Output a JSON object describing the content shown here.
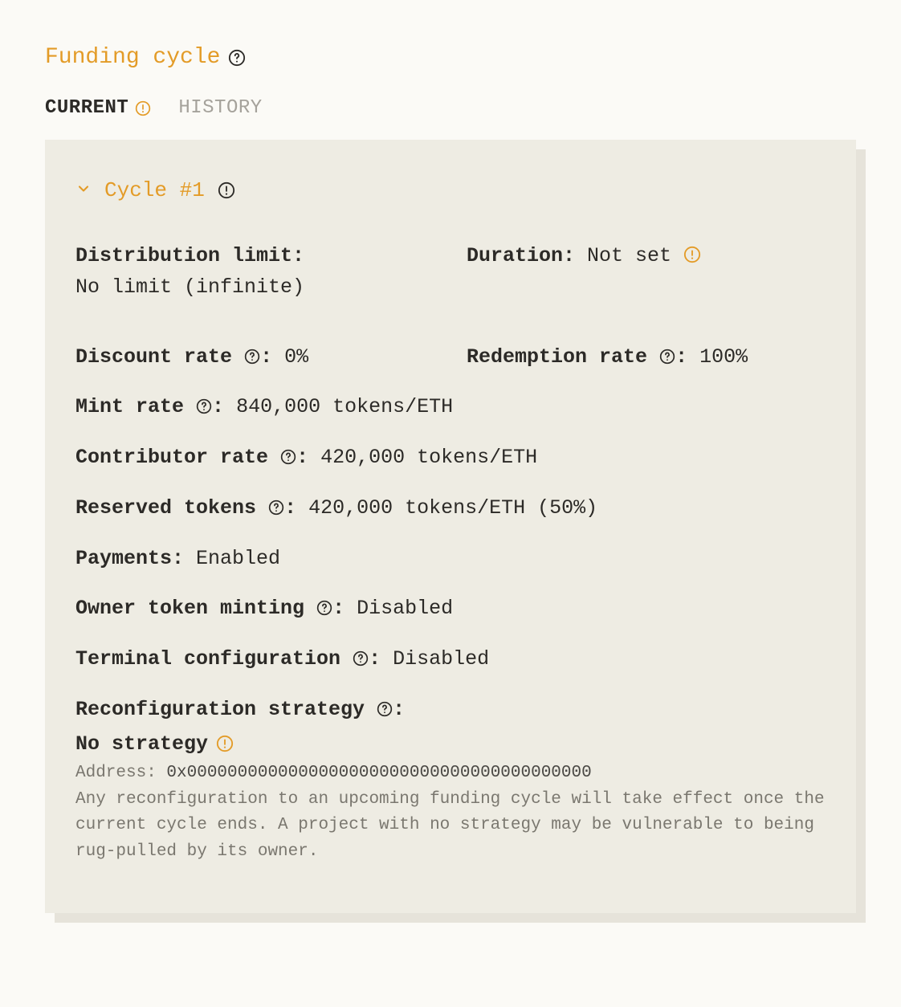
{
  "section": {
    "title": "Funding cycle"
  },
  "tabs": {
    "current": "CURRENT",
    "history": "HISTORY"
  },
  "cycle": {
    "title": "Cycle #1"
  },
  "fields": {
    "distribution_limit": {
      "label": "Distribution limit",
      "value": "No limit (infinite)"
    },
    "duration": {
      "label": "Duration",
      "value": "Not set"
    },
    "discount_rate": {
      "label": "Discount rate",
      "value": "0%"
    },
    "redemption_rate": {
      "label": "Redemption rate",
      "value": "100%"
    },
    "mint_rate": {
      "label": "Mint rate",
      "value": "840,000 tokens/ETH"
    },
    "contributor_rate": {
      "label": "Contributor rate",
      "value": "420,000 tokens/ETH"
    },
    "reserved_tokens": {
      "label": "Reserved tokens",
      "value": "420,000 tokens/ETH (50%)"
    },
    "payments": {
      "label": "Payments",
      "value": "Enabled"
    },
    "owner_token_minting": {
      "label": "Owner token minting",
      "value": "Disabled"
    },
    "terminal_configuration": {
      "label": "Terminal configuration",
      "value": "Disabled"
    },
    "reconfig_strategy": {
      "label": "Reconfiguration strategy",
      "value": "No strategy",
      "address_label": "Address: ",
      "address": "0x0000000000000000000000000000000000000000",
      "warning": "Any reconfiguration to an upcoming funding cycle will take effect once the current cycle ends. A project with no strategy may be vulnerable to being rug-pulled by its owner."
    }
  }
}
